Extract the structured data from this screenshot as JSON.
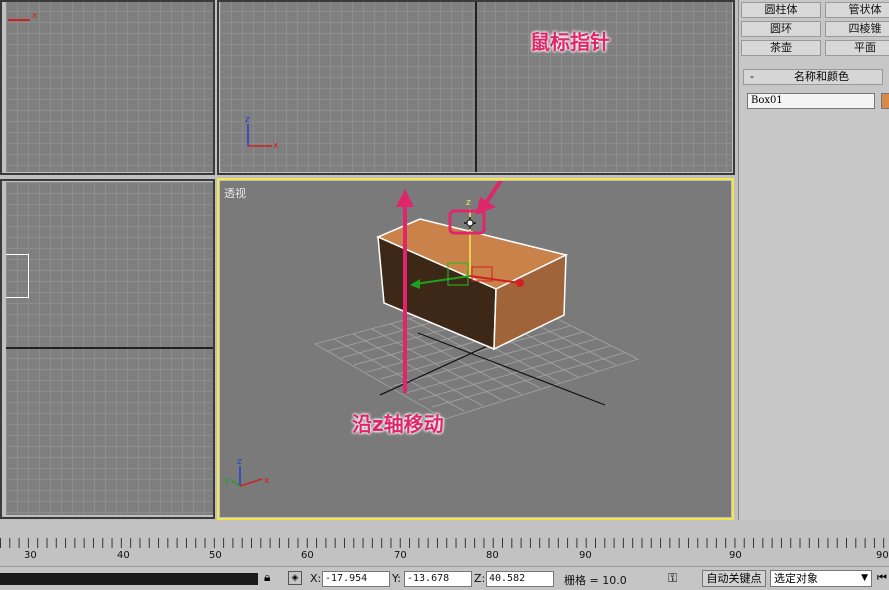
{
  "panel": {
    "buttons": [
      {
        "label": "圆柱体"
      },
      {
        "label": "管状体"
      },
      {
        "label": "圆环"
      },
      {
        "label": "四棱锥"
      },
      {
        "label": "茶壶"
      },
      {
        "label": "平面"
      }
    ],
    "rollout_sign": "-",
    "rollout_title": "名称和颜色",
    "object_name": "Box01",
    "object_color": "#d88a4a"
  },
  "viewports": {
    "perspective_label": "透视",
    "axis_x": "x",
    "axis_y": "y",
    "axis_z": "z"
  },
  "annotations": {
    "mouse_pointer": "鼠标指针",
    "move_along_z": "沿z轴移动"
  },
  "ruler": {
    "ticks": [
      "30",
      "40",
      "50",
      "60",
      "70",
      "80",
      "90",
      "90",
      "90"
    ]
  },
  "status": {
    "x_label": "X:",
    "x_value": "-17.954",
    "y_label": "Y:",
    "y_value": "-13.678",
    "z_label": "Z:",
    "z_value": "40.582",
    "grid_text": "栅格 = 10.0",
    "auto_key": "自动关键点",
    "selection_filter": "选定对象"
  },
  "colors": {
    "accent_pink": "#e0266a",
    "active_viewport": "#f2e84a",
    "box_top": "#c8824a",
    "box_front": "#3d2818",
    "box_side": "#a0643a"
  }
}
